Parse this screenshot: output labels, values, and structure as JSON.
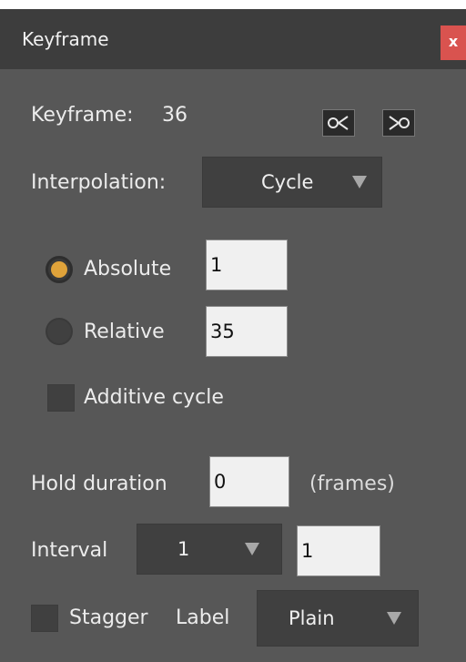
{
  "window": {
    "title": "Keyframe",
    "close_label": "x"
  },
  "keyframe": {
    "label": "Keyframe:",
    "value": "36",
    "prev_icon": "prev-keyframe-icon",
    "next_icon": "next-keyframe-icon"
  },
  "interpolation": {
    "label": "Interpolation:",
    "selected": "Cycle"
  },
  "mode": {
    "absolute_label": "Absolute",
    "absolute_value": "1",
    "absolute_selected": true,
    "relative_label": "Relative",
    "relative_value": "35",
    "relative_selected": false,
    "additive_label": "Additive cycle",
    "additive_checked": false
  },
  "hold": {
    "label": "Hold duration",
    "value": "0",
    "unit": "(frames)"
  },
  "interval": {
    "label": "Interval",
    "selected": "1",
    "value": "1"
  },
  "stagger": {
    "label": "Stagger",
    "checked": false,
    "label_caption": "Label",
    "label_selected": "Plain"
  },
  "colors": {
    "panel": "#575757",
    "titlebar": "#3d3d3d",
    "close": "#d9534f",
    "radio_accent": "#e0a33a"
  }
}
